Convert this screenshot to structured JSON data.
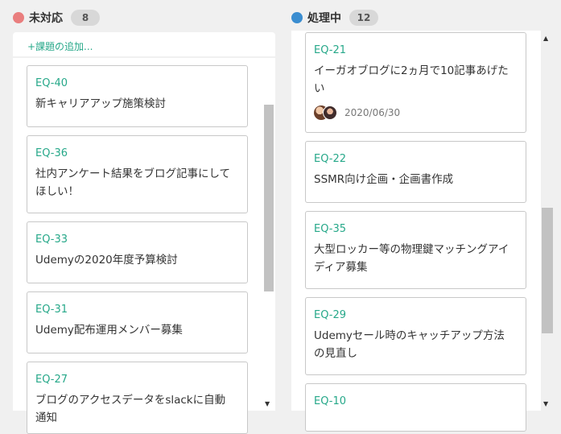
{
  "columns": [
    {
      "title": "未対応",
      "count": "8",
      "color": "#e97e7e",
      "add_label": "+課題の追加...",
      "cards": [
        {
          "key": "EQ-40",
          "title": "新キャリアアップ施策検討"
        },
        {
          "key": "EQ-36",
          "title": "社内アンケート結果をブログ記事にして\nほしい！"
        },
        {
          "key": "EQ-33",
          "title": "Udemyの2020年度予算検討"
        },
        {
          "key": "EQ-31",
          "title": "Udemy配布運用メンバー募集"
        },
        {
          "key": "EQ-27",
          "title": "ブログのアクセスデータをslackに自動\n通知"
        }
      ]
    },
    {
      "title": "処理中",
      "count": "12",
      "color": "#3a8dd0",
      "cards": [
        {
          "key": "EQ-21",
          "title": "イーガオブログに2ヵ月で10記事あげた\nい",
          "date": "2020/06/30"
        },
        {
          "key": "EQ-22",
          "title": "SSMR向け企画・企画書作成"
        },
        {
          "key": "EQ-35",
          "title": "大型ロッカー等の物理鍵マッチングアイ\nディア募集"
        },
        {
          "key": "EQ-29",
          "title": "Udemyセール時のキャッチアップ方法\nの見直し"
        },
        {
          "key": "EQ-10",
          "title": ""
        }
      ]
    }
  ],
  "icons": {
    "scroll_up": "▲",
    "scroll_down": "▼"
  }
}
